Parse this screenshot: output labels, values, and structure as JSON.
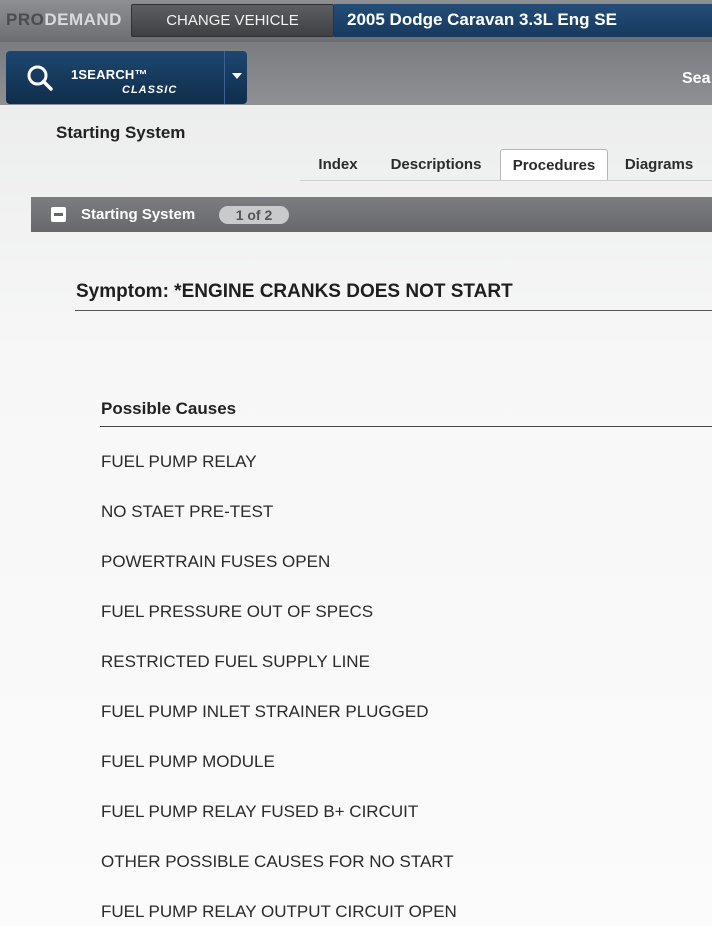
{
  "header": {
    "logo_pro": "PRO",
    "logo_demand": "DEMAND",
    "change_vehicle_label": "CHANGE VEHICLE",
    "vehicle": "2005 Dodge Caravan 3.3L Eng SE"
  },
  "search": {
    "label": "1SEARCH™",
    "sublabel": "CLASSIC",
    "right_label": "Sea"
  },
  "page": {
    "title": "Starting System",
    "tabs": [
      {
        "label": "Index",
        "active": false
      },
      {
        "label": "Descriptions",
        "active": false
      },
      {
        "label": "Procedures",
        "active": true
      },
      {
        "label": "Diagrams",
        "active": false
      }
    ]
  },
  "section": {
    "title": "Starting System",
    "pager": "1 of 2"
  },
  "content": {
    "symptom": "Symptom: *ENGINE CRANKS DOES NOT START",
    "causes_header": "Possible Causes",
    "causes": [
      "FUEL PUMP RELAY",
      "NO STAET PRE-TEST",
      "POWERTRAIN FUSES OPEN",
      "FUEL PRESSURE OUT OF SPECS",
      "RESTRICTED FUEL SUPPLY LINE",
      "FUEL PUMP INLET STRAINER PLUGGED",
      "FUEL PUMP MODULE",
      "FUEL PUMP RELAY FUSED B+ CIRCUIT",
      "OTHER POSSIBLE CAUSES FOR NO START",
      "FUEL PUMP RELAY OUTPUT CIRCUIT OPEN"
    ]
  },
  "colors": {
    "accent": "#1a426b",
    "topbar": "#7a7c7f"
  },
  "icons": {
    "search": "search-icon",
    "caret": "chevron-down-icon",
    "collapse": "collapse-minus-icon"
  }
}
